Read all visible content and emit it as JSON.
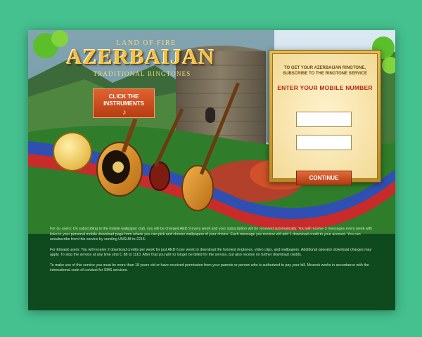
{
  "logo": {
    "tagline_top": "LAND OF FIRE",
    "title": "AZERBAIJAN",
    "tagline_bottom": "TRADITIONAL RINGTONES"
  },
  "cta": {
    "label": "CLICK THE INSTRUMENTS",
    "note_icon": "treble-clef-icon",
    "note_glyph": "♪"
  },
  "subscribe_panel": {
    "heading": "TO GET YOUR AZERBAIJAN RINGTONE, SUBSCRIBE TO THE RINGTONE SERVICE",
    "title": "ENTER YOUR MOBILE NUMBER",
    "field1_value": "",
    "field2_value": "",
    "continue_label": "CONTINUE"
  },
  "terms": [
    "For du users: On subscribing to the mobile wallpaper club, you will be charged AED 9 every week and your subscription will be renewed automatically. You will receive 3 messages every week with links to your personal mobile download page from where you can pick and choose wallpapers of your choice. Each message you receive will add 1 download credit to your account. You can unsubscribe from this service by sending UNSUB to 2215.",
    "For Etisalat users: You will receive 2 download credits per week for just AED 6 per week to download the funniest ringtones, video clips, and wallpapers. Additional operator download charges may apply. To stop the service at any time sms C 88 to 1110. After that you will no longer be billed for the service, but also receive no further download credits.",
    "To make use of this service you must be more than 18 years old or have received permission from your parents or person who is authorized to pay your bill. Mozook works in accordance with the international code of conduct for SMS services."
  ],
  "colors": {
    "background": "#45c08f",
    "page": "#0f4a1e",
    "cta": "#d4511f",
    "panel_gold": "#e3bd58",
    "panel_title": "#b32914",
    "ribbon_blue": "#2f4fb3",
    "ribbon_red": "#c92a2a"
  }
}
